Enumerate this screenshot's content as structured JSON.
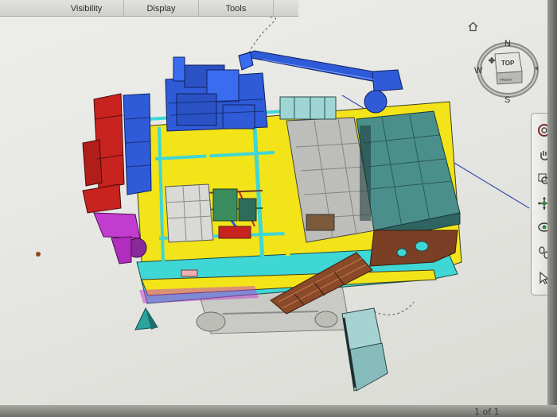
{
  "menubar": {
    "items": [
      {
        "label": "Visibility"
      },
      {
        "label": "Display"
      },
      {
        "label": "Tools"
      }
    ]
  },
  "viewcube": {
    "compass": {
      "north": "N",
      "south": "S",
      "west": "W"
    },
    "top_face": "TOP",
    "front_face": "FRONT"
  },
  "navigation_bar": {
    "buttons": [
      {
        "icon": "steering-wheel-icon"
      },
      {
        "icon": "pan-hand-icon"
      },
      {
        "icon": "zoom-icon"
      },
      {
        "icon": "orbit-icon"
      },
      {
        "icon": "look-icon"
      },
      {
        "icon": "walk-icon"
      },
      {
        "icon": "select-arrow-icon"
      }
    ]
  },
  "status": {
    "page_indicator": "1 of 1"
  },
  "model": {
    "description_colors": {
      "structure_blue": "#2f5bd8",
      "equipment_red": "#c8231e",
      "piping_yellow": "#f2e419",
      "cyan": "#3fd6d6",
      "teal_container": "#4a8f8c",
      "magenta": "#c23ccf",
      "rust": "#8a4a2a",
      "grey": "#b7b7b3"
    }
  }
}
